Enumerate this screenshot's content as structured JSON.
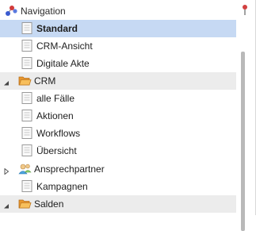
{
  "header": {
    "title": "Navigation",
    "nav_icon": "navigation-network-icon",
    "pin_icon": "pin-icon"
  },
  "items": [
    {
      "label": "Standard",
      "icon": "document-icon",
      "selected": true
    },
    {
      "label": "CRM-Ansicht",
      "icon": "document-icon"
    },
    {
      "label": "Digitale Akte",
      "icon": "document-icon"
    },
    {
      "label": "CRM",
      "icon": "folder-open-icon",
      "group": true,
      "expanded": true
    },
    {
      "label": "alle Fälle",
      "icon": "document-icon"
    },
    {
      "label": "Aktionen",
      "icon": "document-icon"
    },
    {
      "label": "Workflows",
      "icon": "document-icon"
    },
    {
      "label": "Übersicht",
      "icon": "document-icon"
    },
    {
      "label": "Ansprechpartner",
      "icon": "contacts-icon",
      "collapsed": true
    },
    {
      "label": "Kampagnen",
      "icon": "document-icon"
    },
    {
      "label": "Salden",
      "icon": "folder-open-icon",
      "group": true,
      "expanded": true
    }
  ],
  "colors": {
    "selected_bg": "#c6d9f3",
    "group_bg": "#ececec",
    "folder": "#f2a33a"
  }
}
